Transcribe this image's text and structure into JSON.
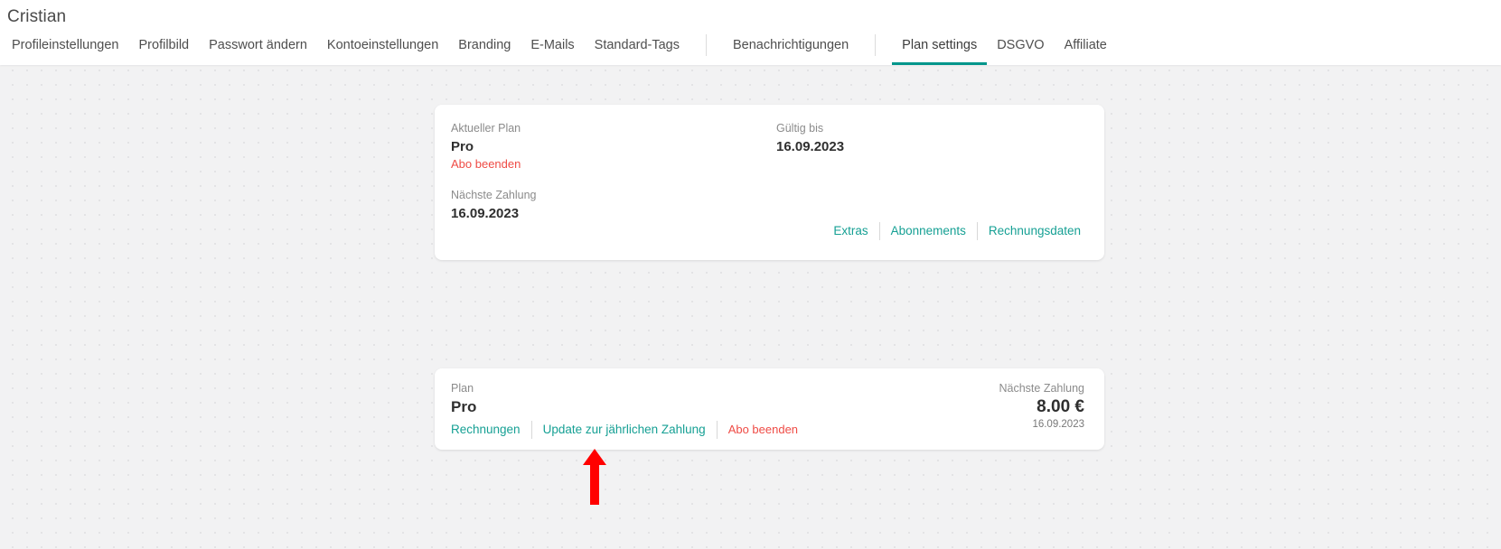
{
  "header": {
    "title": "Cristian",
    "tabs": [
      {
        "label": "Profileinstellungen",
        "active": false,
        "sep_after": false
      },
      {
        "label": "Profilbild",
        "active": false,
        "sep_after": false
      },
      {
        "label": "Passwort ändern",
        "active": false,
        "sep_after": false
      },
      {
        "label": "Kontoeinstellungen",
        "active": false,
        "sep_after": false
      },
      {
        "label": "Branding",
        "active": false,
        "sep_after": false
      },
      {
        "label": "E-Mails",
        "active": false,
        "sep_after": false
      },
      {
        "label": "Standard-Tags",
        "active": false,
        "sep_after": true
      },
      {
        "label": "Benachrichtigungen",
        "active": false,
        "sep_after": true
      },
      {
        "label": "Plan settings",
        "active": true,
        "sep_after": false
      },
      {
        "label": "DSGVO",
        "active": false,
        "sep_after": false
      },
      {
        "label": "Affiliate",
        "active": false,
        "sep_after": false
      }
    ]
  },
  "plan_overview_card": {
    "current_plan_label": "Aktueller Plan",
    "current_plan_value": "Pro",
    "cancel_link": "Abo beenden",
    "next_payment_label": "Nächste Zahlung",
    "next_payment_value": "16.09.2023",
    "valid_until_label": "Gültig bis",
    "valid_until_value": "16.09.2023",
    "links": [
      {
        "label": "Extras"
      },
      {
        "label": "Abonnements"
      },
      {
        "label": "Rechnungsdaten"
      }
    ]
  },
  "subscription_card": {
    "plan_label": "Plan",
    "plan_value": "Pro",
    "invoices_link": "Rechnungen",
    "upgrade_link": "Update zur jährlichen Zahlung",
    "cancel_link": "Abo beenden",
    "next_payment_label": "Nächste Zahlung",
    "amount": "8.00 €",
    "next_payment_date": "16.09.2023"
  },
  "annotation": {
    "arrow_color": "#FF0000",
    "points_to": "Update zur jährlichen Zahlung"
  },
  "colors": {
    "accent_teal": "#16a094",
    "active_tab_underline": "#00968b",
    "danger_red": "#ef4b45",
    "page_background": "#f2f2f3",
    "card_background": "#ffffff"
  }
}
